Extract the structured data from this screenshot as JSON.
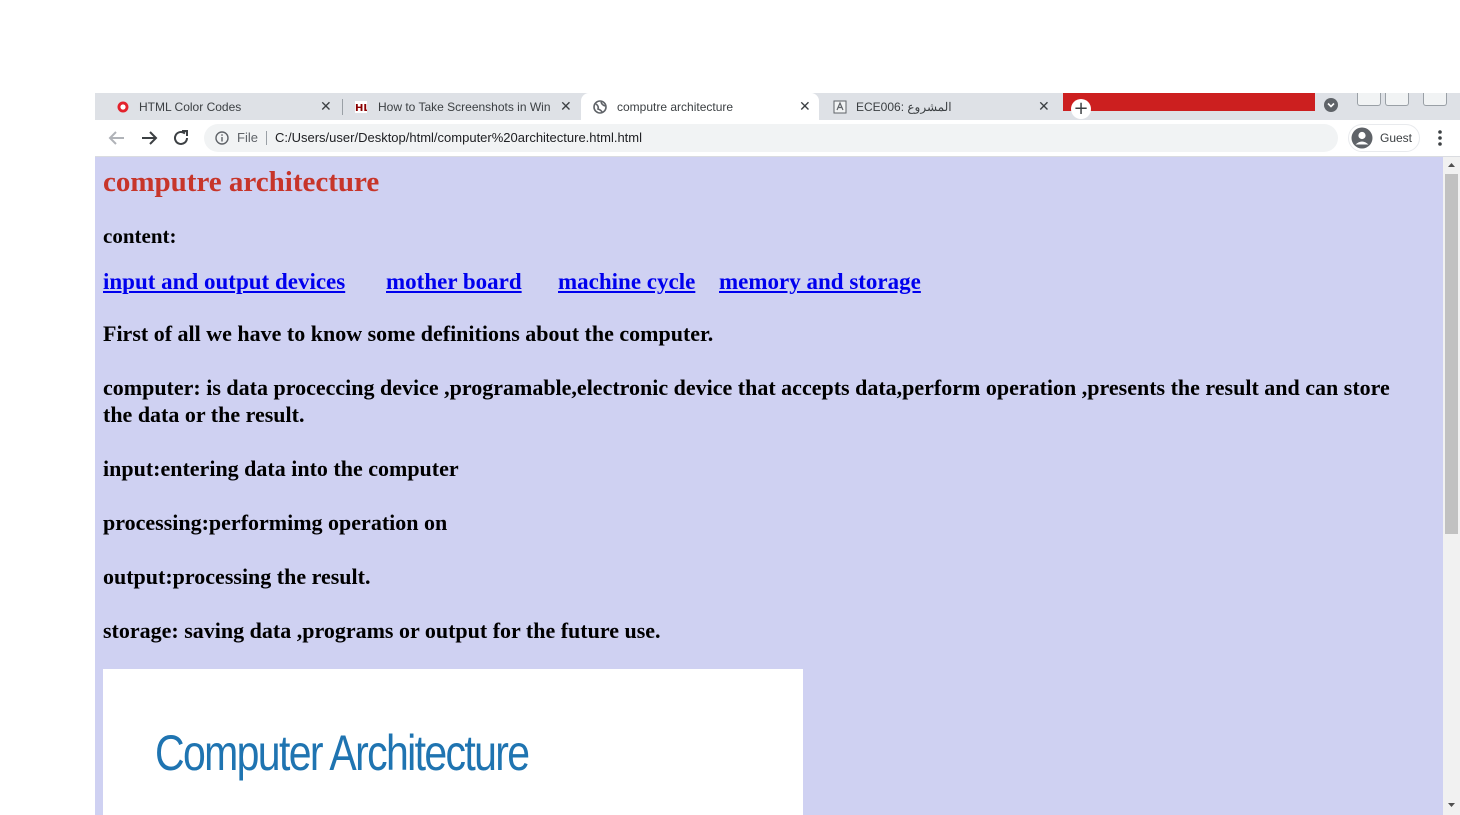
{
  "browser": {
    "tabs": [
      {
        "title": "HTML Color Codes",
        "favicon": "opera-circle-icon"
      },
      {
        "title": "How to Take Screenshots in Wind",
        "favicon": "hl-logo-icon"
      },
      {
        "title": "computre architecture",
        "favicon": "globe-icon",
        "active": true
      },
      {
        "title": "ECE006: المشروع",
        "favicon": "document-icon"
      }
    ],
    "new_tab_symbol": "+",
    "close_symbol": "✕",
    "address": {
      "scheme": "File",
      "url": "C:/Users/user/Desktop/html/computer%20architecture.html.html"
    },
    "profile_name": "Guest",
    "accent_red": "#cc1f1f"
  },
  "page": {
    "title": "computre architecture",
    "content_heading": "content:",
    "links": [
      "input and output devices",
      "mother board",
      "machine cycle",
      "memory and storage"
    ],
    "paragraphs": [
      "First of all we have to know some definitions about the computer.",
      "computer: is data proceccing device ,programable,electronic device that accepts data,perform operation ,presents the result and can store the data or the result.",
      "input:entering data into the computer",
      "processing:performimg operation on",
      "output:processing the result.",
      "storage: saving data ,programs or output for the future use."
    ],
    "figure_title": "Computer Architecture",
    "colors": {
      "background": "#cfd1f2",
      "title": "#c7352a",
      "link": "#0000ee"
    }
  }
}
